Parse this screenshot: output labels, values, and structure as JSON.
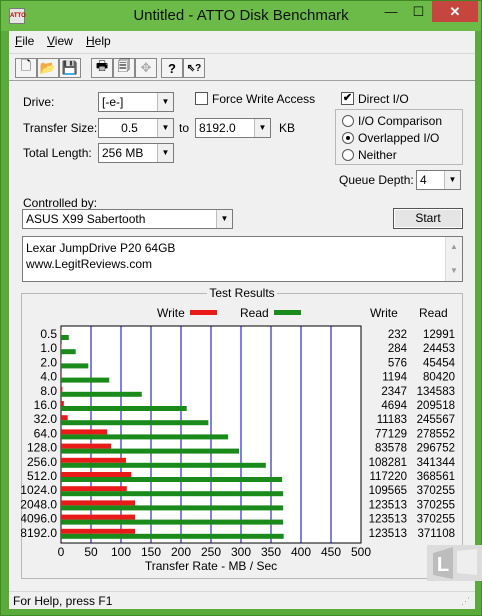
{
  "window": {
    "title": "Untitled - ATTO Disk Benchmark",
    "app_icon": "ATTO",
    "min": "—",
    "max": "☐",
    "close": "✕"
  },
  "menu": [
    {
      "accel": "F",
      "rest": "ile"
    },
    {
      "accel": "V",
      "rest": "iew"
    },
    {
      "accel": "H",
      "rest": "elp"
    }
  ],
  "toolbar": [
    {
      "icon": "new-document-icon",
      "glyph": "🗋"
    },
    {
      "icon": "open-folder-icon",
      "glyph": "📂"
    },
    {
      "icon": "save-icon",
      "glyph": "💾"
    },
    {
      "icon": "print-icon",
      "glyph": "🖶"
    },
    {
      "icon": "print-preview-icon",
      "glyph": "🗐"
    },
    {
      "icon": "move-icon",
      "glyph": "✥"
    },
    {
      "icon": "help-icon",
      "glyph": "?"
    },
    {
      "icon": "context-help-icon",
      "glyph": "⇖?"
    }
  ],
  "form": {
    "drive_label": "Drive:",
    "drive_value": "[-e-]",
    "force_write_label": "Force Write Access",
    "direct_io_label": "Direct I/O",
    "direct_io_checked": "✔",
    "transfer_size_label": "Transfer Size:",
    "transfer_from": "0.5",
    "transfer_to_label": "to",
    "transfer_to": "8192.0",
    "kb_label": "KB",
    "total_length_label": "Total Length:",
    "total_length_value": "256 MB",
    "io_comparison_label": "I/O Comparison",
    "overlapped_io_label": "Overlapped I/O",
    "neither_label": "Neither",
    "queue_depth_label": "Queue Depth:",
    "queue_depth_value": "4",
    "controlled_by_label": "Controlled by:",
    "controlled_by_value": "ASUS X99 Sabertooth",
    "start_label": "Start",
    "description_line1": "Lexar JumpDrive P20 64GB",
    "description_line2": "www.LegitReviews.com"
  },
  "results": {
    "title": "Test Results",
    "write_legend": "Write",
    "read_legend": "Read",
    "write_col": "Write",
    "read_col": "Read",
    "write_values": [
      "232",
      "284",
      "576",
      "1194",
      "2347",
      "4694",
      "11183",
      "77129",
      "83578",
      "108281",
      "117220",
      "109565",
      "123513",
      "123513",
      "123513"
    ],
    "read_values": [
      "12991",
      "24453",
      "45454",
      "80420",
      "134583",
      "209518",
      "245567",
      "278552",
      "296752",
      "341344",
      "368561",
      "370255",
      "370255",
      "370255",
      "371108"
    ]
  },
  "chart_data": {
    "type": "bar",
    "orientation": "horizontal",
    "categories": [
      "0.5",
      "1.0",
      "2.0",
      "4.0",
      "8.0",
      "16.0",
      "32.0",
      "64.0",
      "128.0",
      "256.0",
      "512.0",
      "1024.0",
      "2048.0",
      "4096.0",
      "8192.0"
    ],
    "series": [
      {
        "name": "Write",
        "color": "#e81a1a",
        "values": [
          0.23,
          0.28,
          0.58,
          1.19,
          2.35,
          4.69,
          11.18,
          77.13,
          83.58,
          108.28,
          117.22,
          109.57,
          123.51,
          123.51,
          123.51
        ]
      },
      {
        "name": "Read",
        "color": "#1a8a1a",
        "values": [
          12.99,
          24.45,
          45.45,
          80.42,
          134.58,
          209.52,
          245.57,
          278.55,
          296.75,
          341.34,
          368.56,
          370.26,
          370.26,
          370.26,
          371.11
        ]
      }
    ],
    "xlim": [
      0,
      500
    ],
    "xticks": [
      "0",
      "50",
      "100",
      "150",
      "200",
      "250",
      "300",
      "350",
      "400",
      "450",
      "500"
    ],
    "xlabel": "Transfer Rate - MB / Sec",
    "grid": true
  },
  "status": {
    "text": "For Help, press F1"
  },
  "watermark": {
    "letter": "L"
  }
}
